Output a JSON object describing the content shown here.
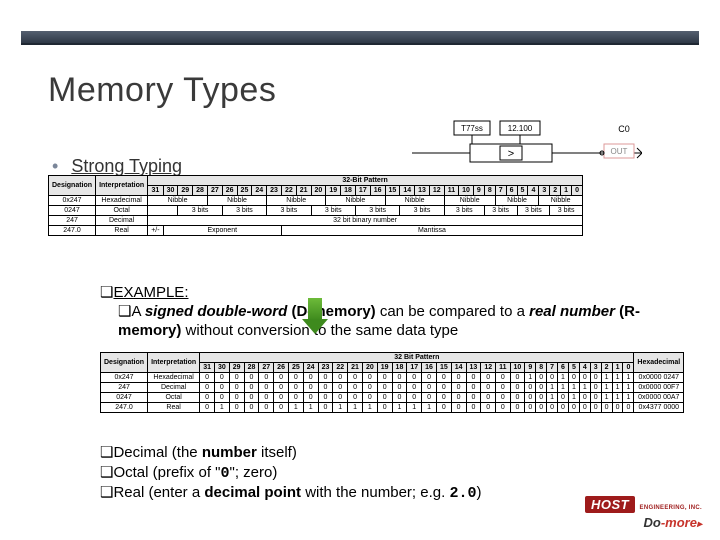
{
  "title": "Memory Types",
  "bullet_main": "Strong Typing",
  "example": {
    "label": "EXAMPLE:",
    "line_pre": "A ",
    "sig_dw": "signed double-word",
    "dmem": " (D-memory)",
    "mid": " can be compared to a ",
    "realnum": "real number",
    "rmem": " (R-memory)",
    "tail": " without conversion to the same data type"
  },
  "lower": {
    "dec_pre": "Decimal (the ",
    "dec_bold": "number",
    "dec_post": " itself)",
    "oct_pre": "Octal (prefix of \"",
    "oct_code": "0",
    "oct_post": "\"; zero)",
    "real_pre": "Real (enter a ",
    "real_bold": "decimal point",
    "real_mid": " with the number; e.g. ",
    "real_code": "2.0",
    "real_post": ")"
  },
  "gate": {
    "in1": "T77ss",
    "in2": "12.100",
    "out_label": "C0",
    "out": "OUT",
    "op": ">"
  },
  "table1": {
    "caption": "32-Bit Pattern",
    "rowhdr": [
      "Designation",
      "Interpretation"
    ],
    "bits": [
      "31",
      "30",
      "29",
      "28",
      "27",
      "26",
      "25",
      "24",
      "23",
      "22",
      "21",
      "20",
      "19",
      "18",
      "17",
      "16",
      "15",
      "14",
      "13",
      "12",
      "11",
      "10",
      "9",
      "8",
      "7",
      "6",
      "5",
      "4",
      "3",
      "2",
      "1",
      "0"
    ],
    "rows": [
      {
        "d": "0x247",
        "i": "Hexadecimal",
        "cells": [
          "Nibble",
          "Nibble",
          "Nibble",
          "Nibble",
          "Nibble",
          "Nibble",
          "Nibble",
          "Nibble"
        ]
      },
      {
        "d": "0247",
        "i": "Octal",
        "cells": [
          "3 bits",
          "3 bits",
          "3 bits",
          "3 bits",
          "3 bits",
          "3 bits",
          "3 bits",
          "3 bits",
          "3 bits",
          "3 bits"
        ]
      },
      {
        "d": "247",
        "i": "Decimal",
        "cells": [
          "32 bit binary number"
        ]
      },
      {
        "d": "247.0",
        "i": "Real",
        "cells": [
          "+/-",
          "Exponent",
          "Mantissa"
        ]
      }
    ]
  },
  "table2": {
    "caption": "32 Bit Pattern",
    "rowhdr": [
      "Designation",
      "Interpretation"
    ],
    "righthdr": "Hexadecimal",
    "bits": [
      "31",
      "30",
      "29",
      "28",
      "27",
      "26",
      "25",
      "24",
      "23",
      "22",
      "21",
      "20",
      "19",
      "18",
      "17",
      "16",
      "15",
      "14",
      "13",
      "12",
      "11",
      "10",
      "9",
      "8",
      "7",
      "6",
      "5",
      "4",
      "3",
      "2",
      "1",
      "0"
    ],
    "rows": [
      {
        "d": "0x247",
        "i": "Hexadecimal",
        "bits": [
          "0",
          "0",
          "0",
          "0",
          "0",
          "0",
          "0",
          "0",
          "0",
          "0",
          "0",
          "0",
          "0",
          "0",
          "0",
          "0",
          "0",
          "0",
          "0",
          "0",
          "0",
          "0",
          "1",
          "0",
          "0",
          "1",
          "0",
          "0",
          "0",
          "1",
          "1",
          "1"
        ],
        "r": "0x0000 0247"
      },
      {
        "d": "247",
        "i": "Decimal",
        "bits": [
          "0",
          "0",
          "0",
          "0",
          "0",
          "0",
          "0",
          "0",
          "0",
          "0",
          "0",
          "0",
          "0",
          "0",
          "0",
          "0",
          "0",
          "0",
          "0",
          "0",
          "0",
          "0",
          "0",
          "0",
          "1",
          "1",
          "1",
          "1",
          "0",
          "1",
          "1",
          "1"
        ],
        "r": "0x0000 00F7"
      },
      {
        "d": "0247",
        "i": "Octal",
        "bits": [
          "0",
          "0",
          "0",
          "0",
          "0",
          "0",
          "0",
          "0",
          "0",
          "0",
          "0",
          "0",
          "0",
          "0",
          "0",
          "0",
          "0",
          "0",
          "0",
          "0",
          "0",
          "0",
          "0",
          "0",
          "1",
          "0",
          "1",
          "0",
          "0",
          "1",
          "1",
          "1"
        ],
        "r": "0x0000 00A7"
      },
      {
        "d": "247.0",
        "i": "Real",
        "bits": [
          "0",
          "1",
          "0",
          "0",
          "0",
          "0",
          "1",
          "1",
          "0",
          "1",
          "1",
          "1",
          "0",
          "1",
          "1",
          "1",
          "0",
          "0",
          "0",
          "0",
          "0",
          "0",
          "0",
          "0",
          "0",
          "0",
          "0",
          "0",
          "0",
          "0",
          "0",
          "0"
        ],
        "r": "0x4377 0000"
      }
    ]
  },
  "logo": {
    "host": "HOST",
    "eng": "ENGINEERING, INC.",
    "do": "Do",
    "more": "-more"
  }
}
